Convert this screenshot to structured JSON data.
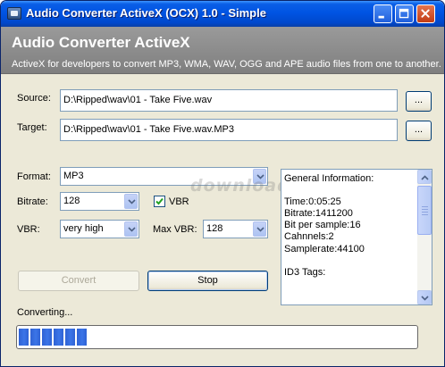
{
  "window": {
    "title": "Audio Converter ActiveX (OCX) 1.0 - Simple",
    "icon": "app-icon",
    "controls": [
      "minimize-icon",
      "maximize-icon",
      "close-icon"
    ]
  },
  "header": {
    "title": "Audio Converter ActiveX",
    "subtitle": "ActiveX for developers to convert MP3, WMA, WAV, OGG and APE audio files from one to another."
  },
  "source": {
    "label": "Source:",
    "value": "D:\\Ripped\\wav\\01 - Take Five.wav",
    "browse_label": "..."
  },
  "target": {
    "label": "Target:",
    "value": "D:\\Ripped\\wav\\01 - Take Five.wav.MP3",
    "browse_label": "..."
  },
  "format": {
    "label": "Format:",
    "value": "MP3"
  },
  "bitrate": {
    "label": "Bitrate:",
    "value": "128"
  },
  "vbr_checkbox": {
    "label": "VBR",
    "checked": true
  },
  "vbr": {
    "label": "VBR:",
    "value": "very high"
  },
  "max_vbr": {
    "label": "Max VBR:",
    "value": "128"
  },
  "buttons": {
    "convert": "Convert",
    "stop": "Stop"
  },
  "info": {
    "lines": [
      "General Information:",
      "",
      "Time:0:05:25",
      "Bitrate:1411200",
      "Bit per sample:16",
      "Cahnnels:2",
      "Samplerate:44100",
      "",
      "ID3 Tags:",
      ""
    ]
  },
  "status": {
    "text": "Converting..."
  },
  "progress": {
    "fraction": 0.19,
    "blocks": 7
  },
  "watermark": "download3k",
  "colors": {
    "titlebar": "#0054e3",
    "header_band": "#8a8a8a",
    "progress": "#2f62d4",
    "window_bg": "#ece9d8"
  }
}
